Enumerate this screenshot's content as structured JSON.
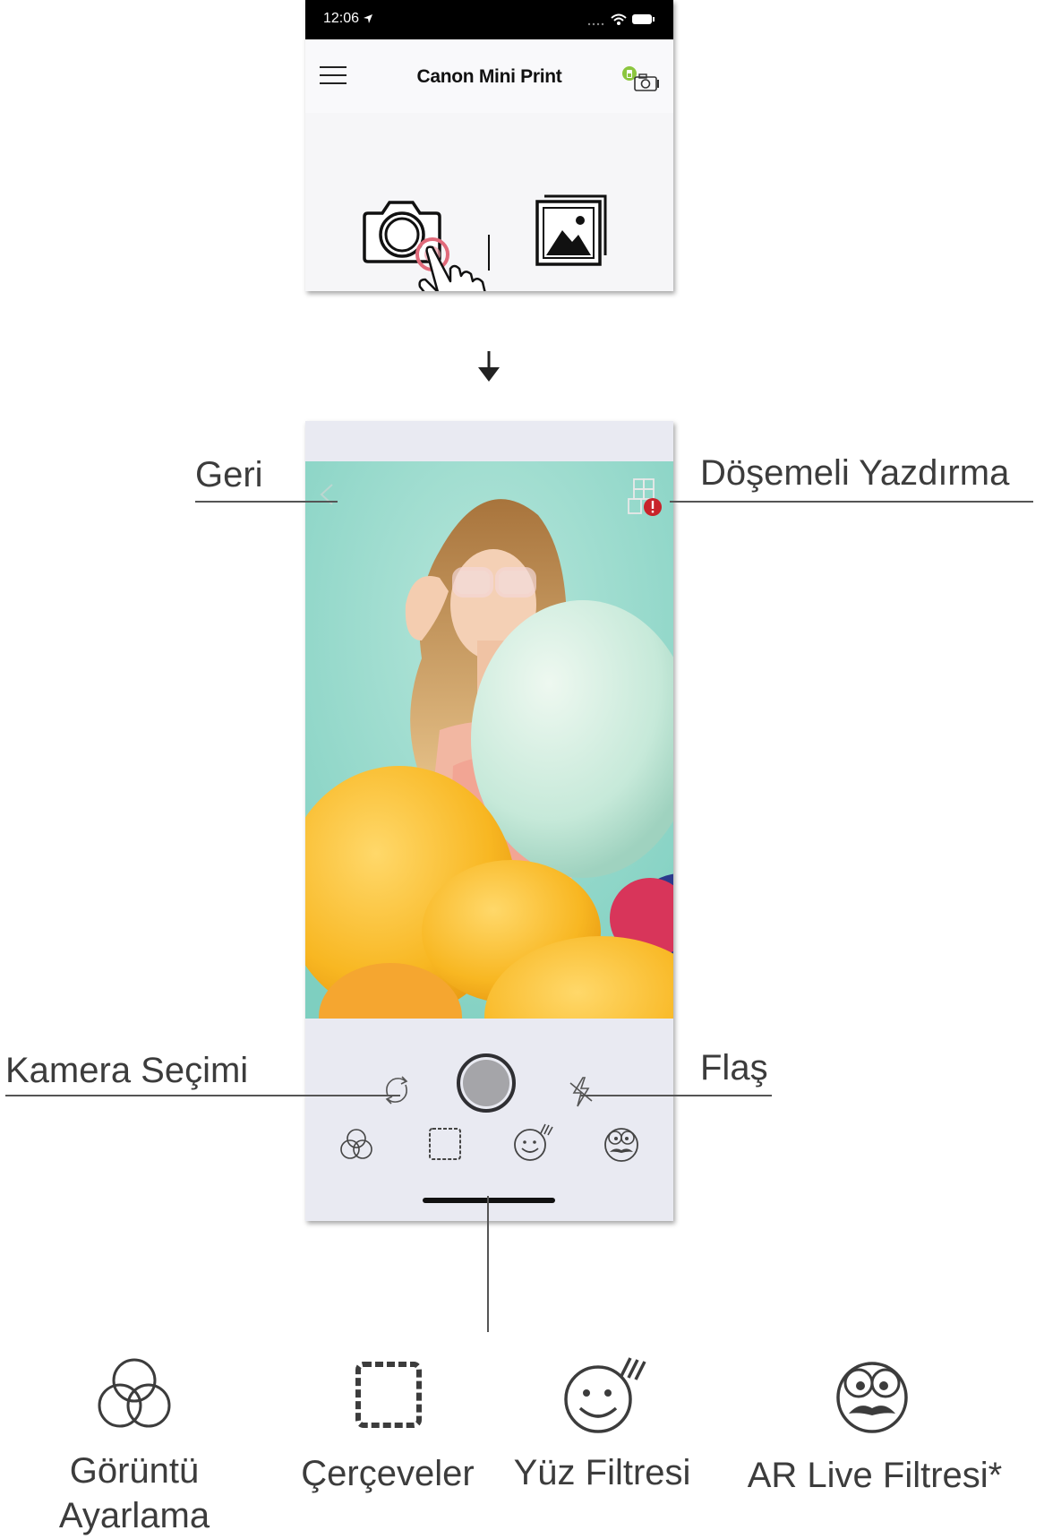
{
  "top_screen": {
    "status_time": "12:06",
    "app_title": "Canon Mini Print"
  },
  "callouts": {
    "back": "Geri",
    "tile_print": "Döşemeli Yazdırma",
    "camera_select": "Kamera Seçimi",
    "flash": "Flaş"
  },
  "features": [
    {
      "label_line1": "Görüntü",
      "label_line2": "Ayarlama",
      "icon": "image-adjust-icon"
    },
    {
      "label_line1": "Çerçeveler",
      "label_line2": "",
      "icon": "frames-icon"
    },
    {
      "label_line1": "Yüz Filtresi",
      "label_line2": "",
      "icon": "face-filter-icon"
    },
    {
      "label_line1": "AR Live Filtresi*",
      "label_line2": "",
      "icon": "ar-live-filter-icon"
    }
  ],
  "colors": {
    "preview_background": "#9ad8cc",
    "notification_badge": "#c8232a",
    "touch_ring": "#e06a7a"
  }
}
